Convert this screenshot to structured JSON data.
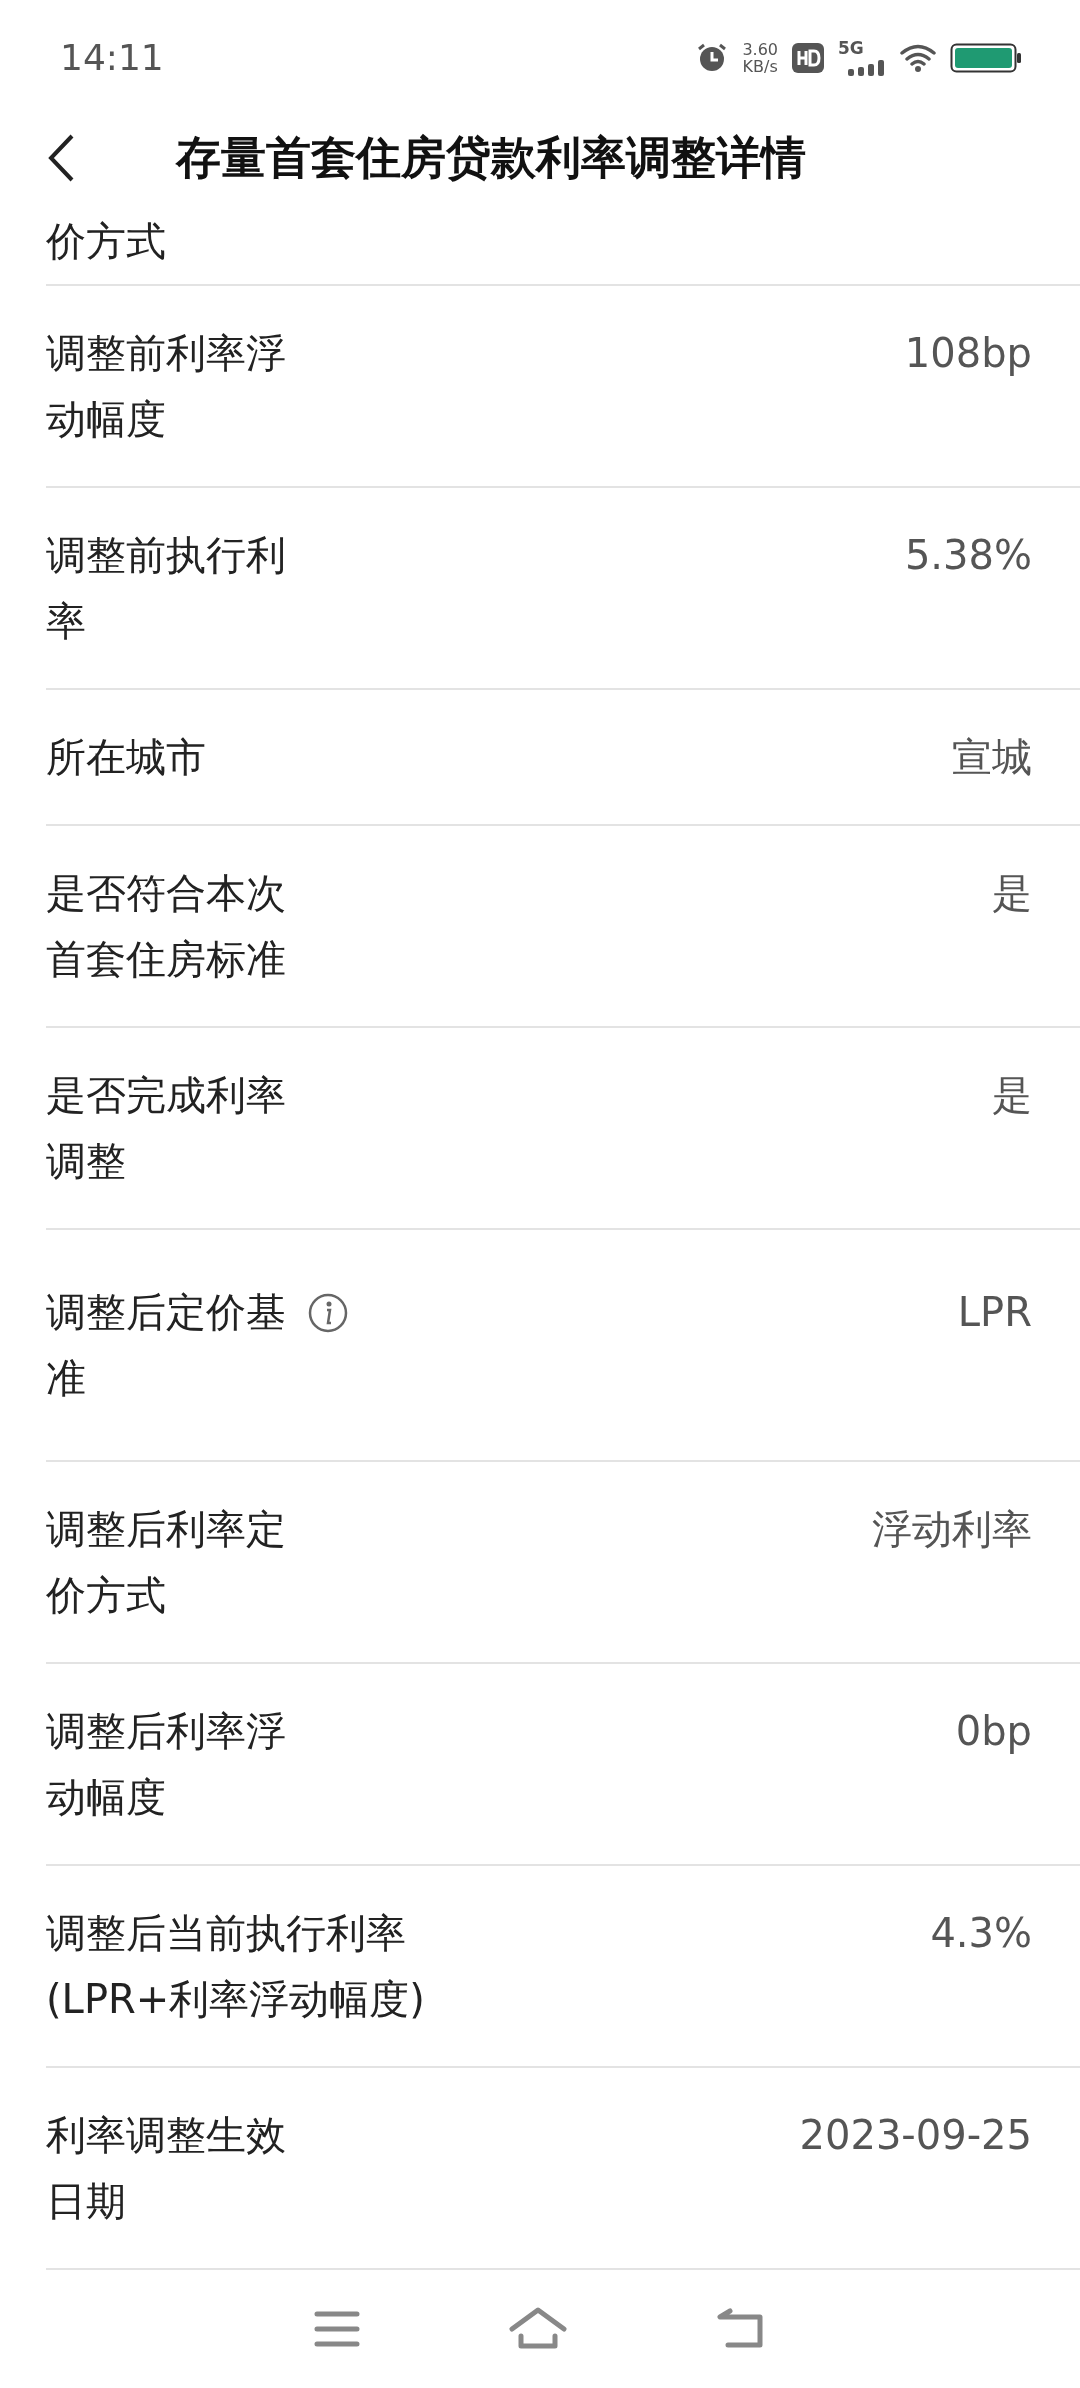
{
  "status_bar": {
    "time": "14:11",
    "speed": "3.60",
    "speed_unit": "KB/s",
    "network": "5G"
  },
  "header": {
    "title": "存量首套住房贷款利率调整详情"
  },
  "partial_row": {
    "label": "价方式"
  },
  "rows": [
    {
      "label": "调整前利率浮动幅度",
      "value": "108bp"
    },
    {
      "label": "调整前执行利率",
      "value": "5.38%"
    },
    {
      "label": "所在城市",
      "value": "宣城"
    },
    {
      "label": "是否符合本次首套住房标准",
      "value": "是"
    },
    {
      "label": "是否完成利率调整",
      "value": "是"
    },
    {
      "label": "调整后定价基准",
      "value": "LPR",
      "info": true
    },
    {
      "label": "调整后利率定价方式",
      "value": "浮动利率"
    },
    {
      "label": "调整后利率浮动幅度",
      "value": "0bp"
    },
    {
      "label": "调整后当前执行利率",
      "note": "(LPR+利率浮动幅度)",
      "value": "4.3%"
    },
    {
      "label": "利率调整生效日期",
      "value": "2023-09-25"
    }
  ]
}
